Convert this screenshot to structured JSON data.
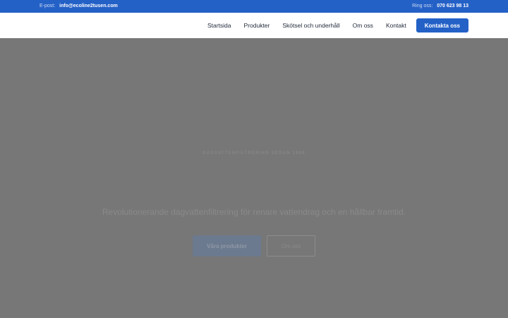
{
  "topbar": {
    "email_label": "E-post:",
    "email_value": "info@ecoline2tusen.com",
    "phone_label": "Ring oss:",
    "phone_value": "070 623 98 13"
  },
  "nav": {
    "items": [
      {
        "label": "Startsida"
      },
      {
        "label": "Produkter"
      },
      {
        "label": "Skötsel och underhåll"
      },
      {
        "label": "Om oss"
      },
      {
        "label": "Kontakt"
      }
    ],
    "cta_label": "Kontakta oss"
  },
  "hero": {
    "eyebrow": "DAGVATTENFILTRERING SEDAN 1998",
    "tagline": "Revolutionerande dagvattenfiltrering för renare vattendrag och en hållbar framtid.",
    "primary_button": "Våra produkter",
    "secondary_button": "Om oss"
  },
  "colors": {
    "brand_blue": "#2461c7",
    "hero_overlay": "#777777"
  }
}
